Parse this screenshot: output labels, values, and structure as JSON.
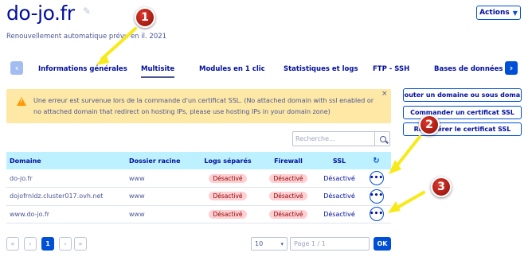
{
  "header": {
    "title": "do-jo.fr",
    "edit_icon": "pencil-icon",
    "renewal_prefix": "Renouvellement automatique prévu en",
    "renewal_suffix": "il. 2021",
    "actions_label": "Actions",
    "actions_chevron": "chevron-down-icon"
  },
  "tabs": [
    {
      "label": "Informations générales",
      "active": false
    },
    {
      "label": "Multisite",
      "active": true
    },
    {
      "label": "Modules en 1 clic",
      "active": false
    },
    {
      "label": "Statistiques et logs",
      "active": false
    },
    {
      "label": "FTP - SSH",
      "active": false
    },
    {
      "label": "Bases de données",
      "active": false
    }
  ],
  "tab_arrows": {
    "prev": "‹",
    "next": "›"
  },
  "alert": {
    "text": "Une erreur est survenue lors de la commande d'un certificat SSL. (No attached domain with ssl enabled or no attached domain that redirect on hosting IPs, please use hosting IPs in your domain zone)",
    "close": "×",
    "icon": "warning-icon"
  },
  "side_buttons": {
    "add_domain": "Ajouter un domaine ou sous doma...",
    "order_ssl": "Commander un certificat SSL",
    "regen_ssl_prefix": "Re",
    "regen_ssl_suffix": "érer le certificat SSL"
  },
  "search": {
    "placeholder": "Recherche...",
    "icon": "search-icon"
  },
  "table": {
    "headers": {
      "domain": "Domaine",
      "root": "Dossier racine",
      "logs": "Logs séparés",
      "firewall": "Firewall",
      "ssl": "SSL",
      "refresh_icon": "refresh-icon"
    },
    "rows": [
      {
        "domain": "do-jo.fr",
        "root": "www",
        "logs": "Désactivé",
        "firewall": "Désactivé",
        "ssl": "Désactivé",
        "more": "•••"
      },
      {
        "domain": "dojofrnldz.cluster017.ovh.net",
        "root": "www",
        "logs": "Désactivé",
        "firewall": "Désactivé",
        "ssl": "Désactivé",
        "more": "•••"
      },
      {
        "domain": "www.do-jo.fr",
        "root": "www",
        "logs": "Désactivé",
        "firewall": "Désactivé",
        "ssl": "Désactivé",
        "more": "•••"
      }
    ]
  },
  "pagination": {
    "first": "«",
    "prev": "‹",
    "current": "1",
    "next": "›",
    "last": "»",
    "per_page": "10",
    "page_info": "Page 1 / 1",
    "ok": "OK"
  },
  "callouts": [
    "1",
    "2",
    "3"
  ],
  "colors": {
    "brand_dark": "#000e9c",
    "brand_blue": "#0050d7",
    "text": "#4d5693",
    "alert_bg": "#fde8a5",
    "table_header_bg": "#bef1ff",
    "badge_bg": "#ffcfd2",
    "callout_red": "#c0261a",
    "arrow_yellow": "#f7ea1a"
  }
}
